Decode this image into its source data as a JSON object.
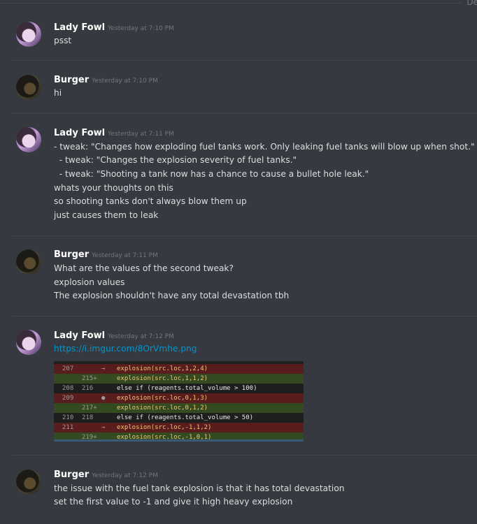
{
  "header": {
    "corner_text": "De"
  },
  "messages": [
    {
      "author": "Lady Fowl",
      "timestamp": "Yesterday at 7:10 PM",
      "lines": [
        "psst"
      ]
    },
    {
      "author": "Burger",
      "timestamp": "Yesterday at 7:10 PM",
      "lines": [
        "hi"
      ]
    },
    {
      "author": "Lady Fowl",
      "timestamp": "Yesterday at 7:11 PM",
      "lines": [
        "- tweak: \"Changes how exploding fuel tanks work. Only leaking fuel tanks will blow up when shot.\"",
        "  - tweak: \"Changes the explosion severity of fuel tanks.\"",
        "  - tweak: \"Shooting a tank now has a chance to cause a bullet hole leak.\"",
        "whats your thoughts on this",
        "so shooting tanks don't always blow them up",
        "just causes them to leak"
      ]
    },
    {
      "author": "Burger",
      "timestamp": "Yesterday at 7:11 PM",
      "lines": [
        "What are the values of the second tweak?",
        "explosion values",
        "The explosion shouldn't have any total devastation tbh"
      ]
    },
    {
      "author": "Lady Fowl",
      "timestamp": "Yesterday at 7:12 PM",
      "link": "https://i.imgur.com/8OrVmhe.png",
      "code_rows": [
        {
          "type": "del",
          "ln1": "207",
          "ln2": "",
          "mark": "→",
          "code": "explosion(src.loc,1,2,4)"
        },
        {
          "type": "add",
          "ln1": "",
          "ln2": "215+",
          "mark": "",
          "code": "explosion(src.loc,1,1,2)"
        },
        {
          "type": "neu",
          "ln1": "208",
          "ln2": "216",
          "mark": "",
          "code": "else if (reagents.total_volume > 100)"
        },
        {
          "type": "del",
          "ln1": "209",
          "ln2": "",
          "mark": "●",
          "code": "explosion(src.loc,0,1,3)"
        },
        {
          "type": "add",
          "ln1": "",
          "ln2": "217+",
          "mark": "",
          "code": "explosion(src.loc,0,1,2)"
        },
        {
          "type": "neu",
          "ln1": "210",
          "ln2": "218",
          "mark": "",
          "code": "else if (reagents.total_volume > 50)"
        },
        {
          "type": "del",
          "ln1": "211",
          "ln2": "",
          "mark": "→",
          "code": "explosion(src.loc,-1,1,2)"
        },
        {
          "type": "add",
          "ln1": "",
          "ln2": "219+",
          "mark": "",
          "code": "explosion(src.loc,-1,0,1)"
        }
      ]
    },
    {
      "author": "Burger",
      "timestamp": "Yesterday at 7:12 PM",
      "lines": [
        "the issue with the fuel tank explosion is that it has total devastation",
        "set the first value to -1 and give it high heavy explosion"
      ]
    }
  ]
}
